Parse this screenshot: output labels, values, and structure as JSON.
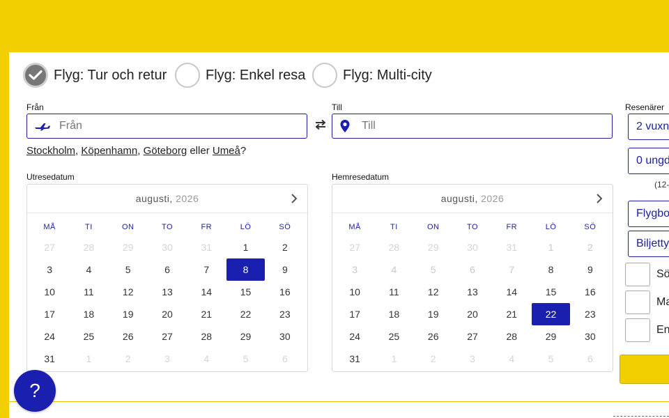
{
  "trip_types": [
    {
      "label": "Flyg: Tur och retur",
      "checked": true
    },
    {
      "label": "Flyg: Enkel resa",
      "checked": false
    },
    {
      "label": "Flyg: Multi-city",
      "checked": false
    }
  ],
  "from": {
    "label": "Från",
    "placeholder": "Från"
  },
  "to": {
    "label": "Till",
    "placeholder": "Till"
  },
  "suggestions": {
    "cities": [
      "Stockholm",
      "Köpenhamn",
      "Göteborg",
      "Umeå"
    ],
    "sep1": ", ",
    "sep2": ", ",
    "connector": " eller ",
    "end": "?"
  },
  "outbound": {
    "label": "Utresedatum",
    "month": "augusti,",
    "year": "2026",
    "weekdays": [
      "MÅ",
      "TI",
      "ON",
      "TO",
      "FR",
      "LÖ",
      "SÖ"
    ],
    "days": [
      {
        "d": "27",
        "s": "out"
      },
      {
        "d": "28",
        "s": "out"
      },
      {
        "d": "29",
        "s": "out"
      },
      {
        "d": "30",
        "s": "out"
      },
      {
        "d": "31",
        "s": "out"
      },
      {
        "d": "1",
        "s": ""
      },
      {
        "d": "2",
        "s": ""
      },
      {
        "d": "3",
        "s": ""
      },
      {
        "d": "4",
        "s": ""
      },
      {
        "d": "5",
        "s": ""
      },
      {
        "d": "6",
        "s": ""
      },
      {
        "d": "7",
        "s": ""
      },
      {
        "d": "8",
        "s": "sel"
      },
      {
        "d": "9",
        "s": ""
      },
      {
        "d": "10",
        "s": ""
      },
      {
        "d": "11",
        "s": ""
      },
      {
        "d": "12",
        "s": ""
      },
      {
        "d": "13",
        "s": ""
      },
      {
        "d": "14",
        "s": ""
      },
      {
        "d": "15",
        "s": ""
      },
      {
        "d": "16",
        "s": ""
      },
      {
        "d": "17",
        "s": ""
      },
      {
        "d": "18",
        "s": ""
      },
      {
        "d": "19",
        "s": ""
      },
      {
        "d": "20",
        "s": ""
      },
      {
        "d": "21",
        "s": ""
      },
      {
        "d": "22",
        "s": ""
      },
      {
        "d": "23",
        "s": ""
      },
      {
        "d": "24",
        "s": ""
      },
      {
        "d": "25",
        "s": ""
      },
      {
        "d": "26",
        "s": ""
      },
      {
        "d": "27",
        "s": ""
      },
      {
        "d": "28",
        "s": ""
      },
      {
        "d": "29",
        "s": ""
      },
      {
        "d": "30",
        "s": ""
      },
      {
        "d": "31",
        "s": ""
      },
      {
        "d": "1",
        "s": "out"
      },
      {
        "d": "2",
        "s": "out"
      },
      {
        "d": "3",
        "s": "out"
      },
      {
        "d": "4",
        "s": "out"
      },
      {
        "d": "5",
        "s": "out"
      },
      {
        "d": "6",
        "s": "out"
      }
    ]
  },
  "return": {
    "label": "Hemresedatum",
    "month": "augusti,",
    "year": "2026",
    "weekdays": [
      "MÅ",
      "TI",
      "ON",
      "TO",
      "FR",
      "LÖ",
      "SÖ"
    ],
    "days": [
      {
        "d": "27",
        "s": "out"
      },
      {
        "d": "28",
        "s": "out"
      },
      {
        "d": "29",
        "s": "out"
      },
      {
        "d": "30",
        "s": "out"
      },
      {
        "d": "31",
        "s": "out"
      },
      {
        "d": "1",
        "s": "dis"
      },
      {
        "d": "2",
        "s": "dis"
      },
      {
        "d": "3",
        "s": "dis"
      },
      {
        "d": "4",
        "s": "dis"
      },
      {
        "d": "5",
        "s": "dis"
      },
      {
        "d": "6",
        "s": "dis"
      },
      {
        "d": "7",
        "s": "dis"
      },
      {
        "d": "8",
        "s": ""
      },
      {
        "d": "9",
        "s": ""
      },
      {
        "d": "10",
        "s": ""
      },
      {
        "d": "11",
        "s": ""
      },
      {
        "d": "12",
        "s": ""
      },
      {
        "d": "13",
        "s": ""
      },
      {
        "d": "14",
        "s": ""
      },
      {
        "d": "15",
        "s": ""
      },
      {
        "d": "16",
        "s": ""
      },
      {
        "d": "17",
        "s": ""
      },
      {
        "d": "18",
        "s": ""
      },
      {
        "d": "19",
        "s": ""
      },
      {
        "d": "20",
        "s": ""
      },
      {
        "d": "21",
        "s": ""
      },
      {
        "d": "22",
        "s": "sel"
      },
      {
        "d": "23",
        "s": ""
      },
      {
        "d": "24",
        "s": ""
      },
      {
        "d": "25",
        "s": ""
      },
      {
        "d": "26",
        "s": ""
      },
      {
        "d": "27",
        "s": ""
      },
      {
        "d": "28",
        "s": ""
      },
      {
        "d": "29",
        "s": ""
      },
      {
        "d": "30",
        "s": ""
      },
      {
        "d": "31",
        "s": ""
      },
      {
        "d": "1",
        "s": "out"
      },
      {
        "d": "2",
        "s": "out"
      },
      {
        "d": "3",
        "s": "out"
      },
      {
        "d": "4",
        "s": "out"
      },
      {
        "d": "5",
        "s": "out"
      },
      {
        "d": "6",
        "s": "out"
      }
    ]
  },
  "travellers": {
    "label": "Resenärer",
    "adults": "2 vuxna",
    "youth": "0 ungd",
    "age_hint": "(12-",
    "cabin": "Flygbo",
    "ticket": "Biljetty"
  },
  "checkboxes": [
    "Sö",
    "Ma",
    "En"
  ],
  "help": {
    "label": "?"
  },
  "colors": {
    "brand_yellow": "#f1cf00",
    "brand_blue": "#1b1fb0"
  }
}
